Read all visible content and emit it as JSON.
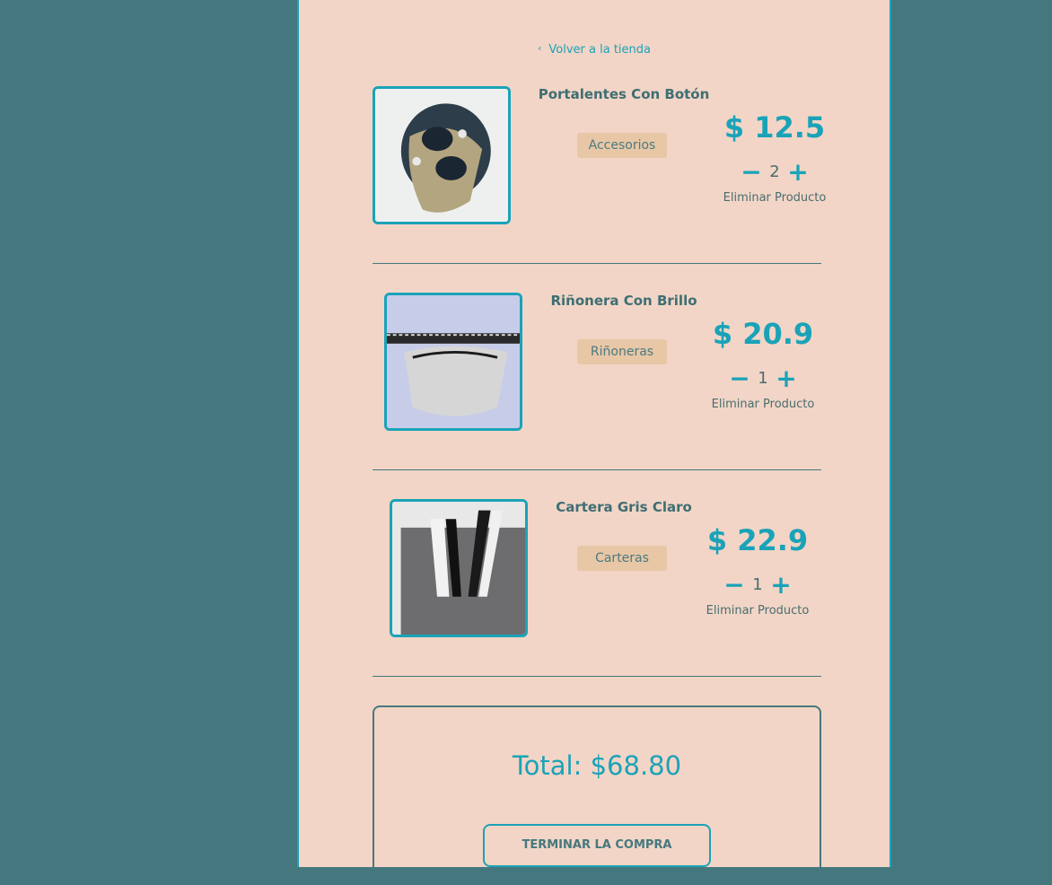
{
  "nav": {
    "back_label": "Volver a la tienda"
  },
  "items": [
    {
      "name": "Portalentes Con Botón",
      "category": "Accesorios",
      "price": "$ 12.5",
      "qty": "2",
      "remove": "Eliminar Producto"
    },
    {
      "name": "Riñonera Con Brillo",
      "category": "Riñoneras",
      "price": "$ 20.9",
      "qty": "1",
      "remove": "Eliminar Producto"
    },
    {
      "name": "Cartera Gris Claro",
      "category": "Carteras",
      "price": "$ 22.9",
      "qty": "1",
      "remove": "Eliminar Producto"
    }
  ],
  "controls": {
    "minus": "−",
    "plus": "+"
  },
  "summary": {
    "total": "Total: $68.80",
    "checkout": "TERMINAR LA COMPRA"
  },
  "colors": {
    "accent": "#1aa3b8",
    "panel": "#f2d5c6",
    "background": "#45787e",
    "badge": "#e8c7a6"
  }
}
